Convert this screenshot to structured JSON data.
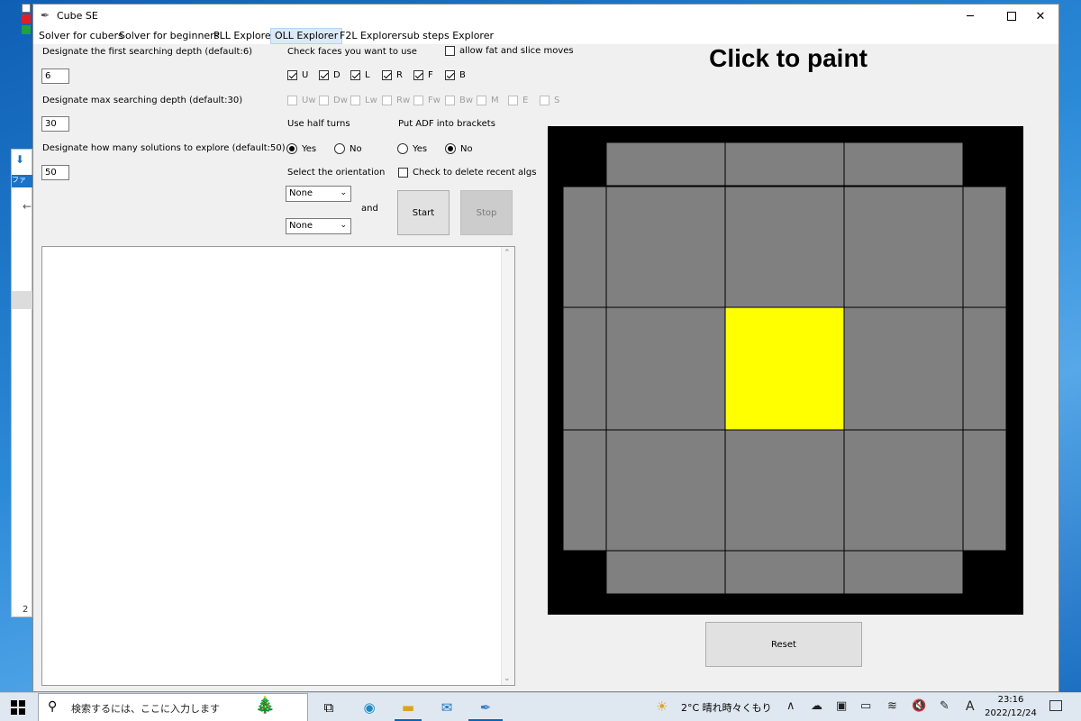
{
  "window": {
    "title": "Cube SE"
  },
  "menu": [
    {
      "label": "Solver for cubers",
      "active": false
    },
    {
      "label": "Solver for beginners",
      "active": false
    },
    {
      "label": "PLL Explorer",
      "active": false
    },
    {
      "label": "OLL Explorer",
      "active": true
    },
    {
      "label": "F2L Explorer",
      "active": false
    },
    {
      "label": "sub steps Explorer",
      "active": false
    }
  ],
  "depth": {
    "first_label": "Designate the first searching depth (default:6)",
    "first_value": "6",
    "max_label": "Designate max searching depth (default:30)",
    "max_value": "30",
    "solutions_label": "Designate how many solutions to explore (default:50)",
    "solutions_value": "50"
  },
  "faces": {
    "label": "Check faces you want to use",
    "fat_label": "allow fat and slice moves",
    "fat_checked": false,
    "primary": [
      {
        "label": "U",
        "checked": true
      },
      {
        "label": "D",
        "checked": true
      },
      {
        "label": "L",
        "checked": true
      },
      {
        "label": "R",
        "checked": true
      },
      {
        "label": "F",
        "checked": true
      },
      {
        "label": "B",
        "checked": true
      }
    ],
    "extra": [
      {
        "label": "Uw",
        "checked": false
      },
      {
        "label": "Dw",
        "checked": false
      },
      {
        "label": "Lw",
        "checked": false
      },
      {
        "label": "Rw",
        "checked": false
      },
      {
        "label": "Fw",
        "checked": false
      },
      {
        "label": "Bw",
        "checked": false
      },
      {
        "label": "M",
        "checked": false
      },
      {
        "label": "E",
        "checked": false
      },
      {
        "label": "S",
        "checked": false
      }
    ]
  },
  "half_turns": {
    "label": "Use half turns",
    "yes": "Yes",
    "no": "No",
    "selected": "yes"
  },
  "adf": {
    "label": "Put ADF into brackets",
    "yes": "Yes",
    "no": "No",
    "selected": "no"
  },
  "orientation": {
    "label": "Select the orientation",
    "first": "None",
    "second": "None",
    "and_label": "and"
  },
  "delete_recent": {
    "label": "Check to delete recent algs",
    "checked": false
  },
  "actions": {
    "start": "Start",
    "stop": "Stop",
    "reset": "Reset"
  },
  "paint": {
    "title": "Click to paint"
  },
  "cube": {
    "colors": {
      "background": "#000000",
      "gray": "#808080",
      "yellow": "#ffff00"
    },
    "top": [
      "gray",
      "gray",
      "gray"
    ],
    "left": [
      "gray",
      "gray",
      "gray"
    ],
    "right": [
      "gray",
      "gray",
      "gray"
    ],
    "bottom": [
      "gray",
      "gray",
      "gray"
    ],
    "face": [
      [
        "gray",
        "gray",
        "gray"
      ],
      [
        "gray",
        "yellow",
        "gray"
      ],
      [
        "gray",
        "gray",
        "gray"
      ]
    ]
  },
  "taskbar": {
    "search_placeholder": "検索するには、ここに入力します",
    "weather": "2°C  晴れ時々くもり",
    "ime": "A",
    "time": "23:16",
    "date": "2022/12/24"
  },
  "background_window": {
    "tab_text": "ファ",
    "page_num": "2"
  }
}
